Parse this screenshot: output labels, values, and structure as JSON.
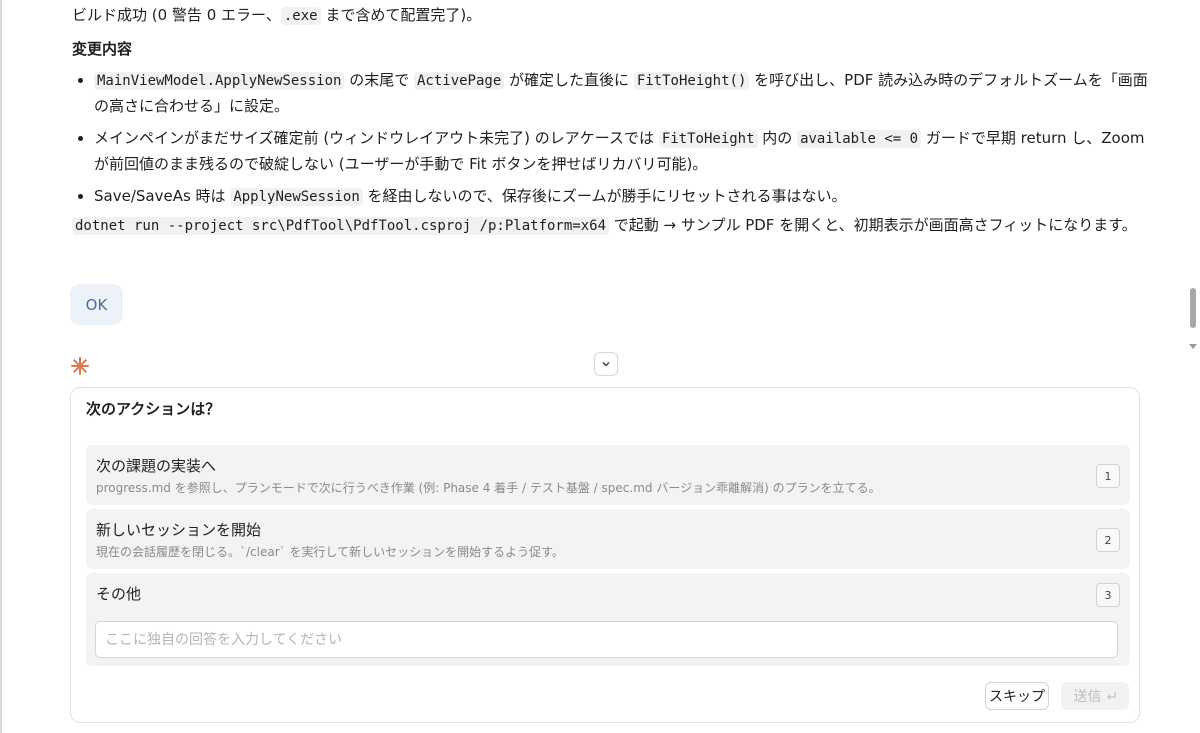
{
  "message": {
    "line1_pre": "ビルド成功 (0 警告 0 エラー、",
    "line1_code": ".exe",
    "line1_post": " まで含めて配置完了)。",
    "heading": "変更内容",
    "bullet1": {
      "code1": "MainViewModel.ApplyNewSession",
      "t1": " の末尾で ",
      "code2": "ActivePage",
      "t2": " が確定した直後に ",
      "code3": "FitToHeight()",
      "t3": " を呼び出し、PDF 読み込み時のデフォルトズームを「画面の高さに合わせる」に設定。"
    },
    "bullet2": {
      "t1": "メインペインがまだサイズ確定前 (ウィンドウレイアウト未完了) のレアケースでは ",
      "code1": "FitToHeight",
      "t2": " 内の ",
      "code2": "available <= 0",
      "t3": " ガードで早期 return し、Zoom が前回値のまま残るので破綻しない (ユーザーが手動で Fit ボタンを押せばリカバリ可能)。"
    },
    "bullet3": {
      "t1": "Save/SaveAs 時は ",
      "code1": "ApplyNewSession",
      "t2": " を経由しないので、保存後にズームが勝手にリセットされる事はない。"
    },
    "run": {
      "code": "dotnet run --project src\\PdfTool\\PdfTool.csproj /p:Platform=x64",
      "text": " で起動 → サンプル PDF を開くと、初期表示が画面高さフィットになります。"
    }
  },
  "user_reply": "OK",
  "question": {
    "title": "次のアクションは？",
    "options": [
      {
        "title": "次の課題の実装へ",
        "desc": "progress.md を参照し、プランモードで次に行うべき作業 (例: Phase 4 着手 / テスト基盤 / spec.md バージョン乖離解消) のプランを立てる。",
        "key": "1"
      },
      {
        "title": "新しいセッションを開始",
        "desc": "現在の会話履歴を閉じる。`/clear` を実行して新しいセッションを開始するよう促す。",
        "key": "2"
      },
      {
        "title": "その他",
        "key": "3",
        "placeholder": "ここに独自の回答を入力してください"
      }
    ],
    "skip_label": "スキップ",
    "send_label": "送信"
  },
  "icons": {
    "spark": "spark-icon",
    "collapse": "chevron-down-icon",
    "send": "enter-icon"
  },
  "colors": {
    "accent_spark": "#d97757",
    "user_bubble": "#edf2f8"
  }
}
